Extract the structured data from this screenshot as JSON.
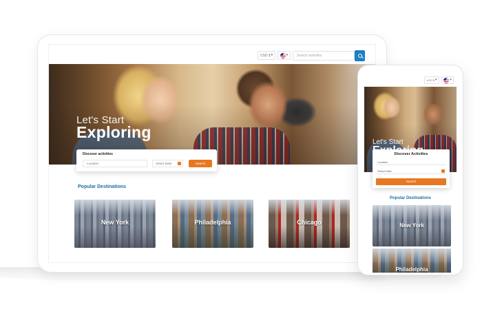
{
  "header": {
    "currency": "USD $",
    "search_placeholder": "Search activities"
  },
  "hero": {
    "line1": "Let's Start",
    "line2": "Exploring"
  },
  "search_card": {
    "title_desktop": "Discover activities",
    "title_mobile": "Discover Activities",
    "location_placeholder": "Location",
    "date_placeholder": "Select Date",
    "button_label": "Search"
  },
  "popular": {
    "heading": "Popular Destinations",
    "destinations": [
      {
        "label": "New York"
      },
      {
        "label": "Philadelphia"
      },
      {
        "label": "Chicago"
      }
    ]
  },
  "icons": {
    "flag": "us-flag-icon",
    "search": "search-icon",
    "calendar": "calendar-icon",
    "dropdown": "chevron-down-icon"
  },
  "colors": {
    "accent": "#e87722",
    "primary": "#1b7fc4",
    "heading": "#1b6fa8"
  }
}
